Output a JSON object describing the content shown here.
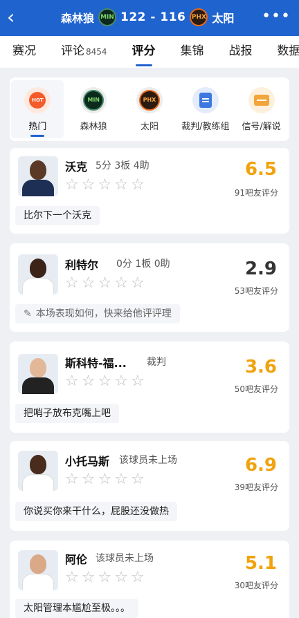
{
  "header": {
    "back_icon": "back-chevron-icon",
    "home_team": "森林狼",
    "home_logo_text": "MIN",
    "score": "122 - 116",
    "away_logo_text": "PHX",
    "away_team": "太阳",
    "more_icon": "more-dots-icon",
    "bg_color": "#1f63cf"
  },
  "tabs": [
    {
      "label": "赛况",
      "sub": ""
    },
    {
      "label": "评论",
      "sub": "8454"
    },
    {
      "label": "评分",
      "sub": "",
      "active": true
    },
    {
      "label": "集锦",
      "sub": ""
    },
    {
      "label": "战报",
      "sub": ""
    },
    {
      "label": "数据",
      "sub": ""
    }
  ],
  "categories": [
    {
      "label": "热门",
      "icon_text": "HOT",
      "active": true
    },
    {
      "label": "森林狼",
      "icon_text": "MIN"
    },
    {
      "label": "太阳",
      "icon_text": "PHX"
    },
    {
      "label": "裁判/教练组",
      "icon_text": ""
    },
    {
      "label": "信号/解说",
      "icon_text": ""
    }
  ],
  "players": [
    {
      "name": "沃克",
      "stat": "5分 3板 4助",
      "rating": "6.5",
      "rating_color": "#f2a20c",
      "count": "91吧友评分",
      "comment": "比尔下一个沃克",
      "prompt": false
    },
    {
      "name": "利特尔",
      "stat": "0分 1板 0助",
      "rating": "2.9",
      "rating_color": "#333333",
      "count": "53吧友评分",
      "comment": "本场表现如何，快来给他评评理",
      "prompt": true
    },
    {
      "name": "斯科特-福...",
      "stat": "裁判",
      "rating": "3.6",
      "rating_color": "#f2a20c",
      "count": "50吧友评分",
      "comment": "把哨子放布克嘴上吧",
      "prompt": false
    },
    {
      "name": "小托马斯",
      "stat": "该球员未上场",
      "rating": "6.9",
      "rating_color": "#f2a20c",
      "count": "39吧友评分",
      "comment": "你说买你来干什么，屁股还没做热",
      "prompt": false
    },
    {
      "name": "阿伦",
      "stat": "该球员未上场",
      "rating": "5.1",
      "rating_color": "#f2a20c",
      "count": "30吧友评分",
      "comment": "太阳管理本尴尬至极。。。",
      "prompt": false
    }
  ]
}
